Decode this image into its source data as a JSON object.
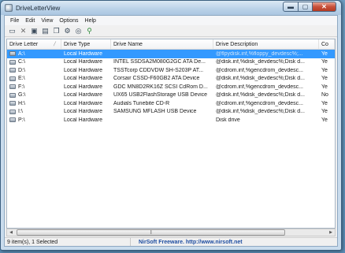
{
  "window": {
    "title": "DriveLetterView"
  },
  "menu": [
    "File",
    "Edit",
    "View",
    "Options",
    "Help"
  ],
  "toolbar": [
    {
      "name": "drive-icon",
      "glyph": "▭"
    },
    {
      "name": "delete-icon",
      "glyph": "✕"
    },
    {
      "name": "save-icon",
      "glyph": "▣"
    },
    {
      "name": "properties-icon",
      "glyph": "▤"
    },
    {
      "name": "copy-icon",
      "glyph": "❐"
    },
    {
      "name": "settings-icon",
      "glyph": "⚙"
    },
    {
      "name": "find-icon",
      "glyph": "◎"
    },
    {
      "name": "exit-icon",
      "glyph": "⚲"
    }
  ],
  "columns": [
    "Drive Letter",
    "Drive Type",
    "Drive Name",
    "Drive Description",
    "Co"
  ],
  "rows": [
    {
      "letter": "A:\\",
      "type": "Local Hardware",
      "name": "",
      "desc": "@flpydisk.inf,%floppy_devdesc%;...",
      "extra": "Ye",
      "selected": true
    },
    {
      "letter": "C:\\",
      "type": "Local Hardware",
      "name": "INTEL SSDSA2M080G2GC ATA De...",
      "desc": "@disk.inf,%disk_devdesc%;Disk d...",
      "extra": "Ye"
    },
    {
      "letter": "D:\\",
      "type": "Local Hardware",
      "name": "TSSTcorp CDDVDW SH-S203P AT...",
      "desc": "@cdrom.inf,%gencdrom_devdesc...",
      "extra": "Ye"
    },
    {
      "letter": "E:\\",
      "type": "Local Hardware",
      "name": "Corsair CSSD-F60GB2 ATA Device",
      "desc": "@disk.inf,%disk_devdesc%;Disk d...",
      "extra": "Ye"
    },
    {
      "letter": "F:\\",
      "type": "Local Hardware",
      "name": "GDC MN8D2RK16Z SCSI CdRom D...",
      "desc": "@cdrom.inf,%gencdrom_devdesc...",
      "extra": "Ye"
    },
    {
      "letter": "G:\\",
      "type": "Local Hardware",
      "name": "UX65 USB2FlashStorage USB Device",
      "desc": "@disk.inf,%disk_devdesc%;Disk d...",
      "extra": "No"
    },
    {
      "letter": "H:\\",
      "type": "Local Hardware",
      "name": "Audials Tunebite CD-R",
      "desc": "@cdrom.inf,%gencdrom_devdesc...",
      "extra": "Ye"
    },
    {
      "letter": "I:\\",
      "type": "Local Hardware",
      "name": "SAMSUNG MFLASH USB Device",
      "desc": "@disk.inf,%disk_devdesc%;Disk d...",
      "extra": "Ye"
    },
    {
      "letter": "P:\\",
      "type": "Local Hardware",
      "name": "",
      "desc": "Disk drive",
      "extra": "Ye"
    }
  ],
  "status": {
    "items": "9 item(s), 1 Selected",
    "credit": "NirSoft Freeware.  http://www.nirsoft.net"
  },
  "colors": {
    "selection": "#3399ff",
    "credit": "#1f4ea1",
    "frame": "#c9dced"
  }
}
